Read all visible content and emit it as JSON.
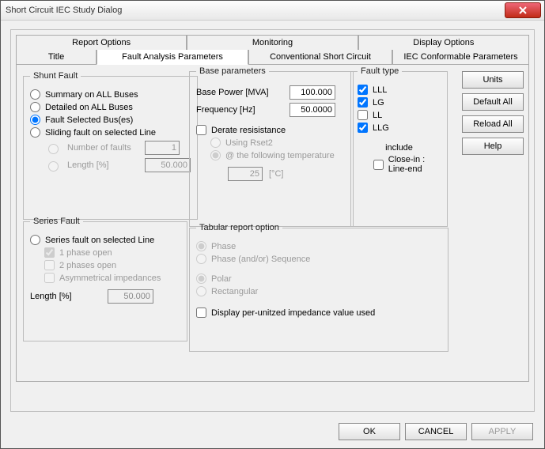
{
  "window": {
    "title": "Short Circuit IEC Study Dialog"
  },
  "tabs_row1": [
    "Report Options",
    "Monitoring",
    "Display Options"
  ],
  "tabs_row2": [
    "Title",
    "Fault Analysis Parameters",
    "Conventional Short Circuit",
    "IEC Conformable Parameters"
  ],
  "shunt": {
    "legend": "Shunt Fault",
    "opts": [
      "Summary on ALL Buses",
      "Detailed on ALL Buses",
      "Fault Selected Bus(es)",
      "Sliding fault on selected Line"
    ],
    "selected": 2,
    "num_faults_label": "Number of faults",
    "num_faults_val": "1",
    "length_label": "Length [%]",
    "length_val": "50.000"
  },
  "series": {
    "legend": "Series Fault",
    "opt": "Series fault on selected Line",
    "c1": "1 phase open",
    "c2": "2 phases open",
    "c3": "Asymmetrical impedances",
    "length_label": "Length [%]",
    "length_val": "50.000"
  },
  "base": {
    "legend": "Base parameters",
    "power_label": "Base Power [MVA]",
    "power_val": "100.000",
    "freq_label": "Frequency [Hz]",
    "freq_val": "50.0000"
  },
  "derate": {
    "label": "Derate resisistance",
    "r1": "Using Rset2",
    "r2": "@ the following temperature",
    "temp_val": "25",
    "temp_unit": "[°C]"
  },
  "tabular": {
    "legend": "Tabular report option",
    "r1": "Phase",
    "r2": "Phase (and/or) Sequence",
    "r3": "Polar",
    "r4": "Rectangular",
    "c1": "Display per-unitzed impedance value used"
  },
  "ftype": {
    "legend": "Fault type",
    "c1": "LLL",
    "c2": "LG",
    "c3": "LL",
    "c4": "LLG",
    "inc_label1": "include",
    "inc_label2": "Close-in :",
    "inc_label3": "Line-end"
  },
  "buttons": {
    "units": "Units",
    "defall": "Default All",
    "reload": "Reload All",
    "help": "Help"
  },
  "footer": {
    "ok": "OK",
    "cancel": "CANCEL",
    "apply": "APPLY"
  }
}
